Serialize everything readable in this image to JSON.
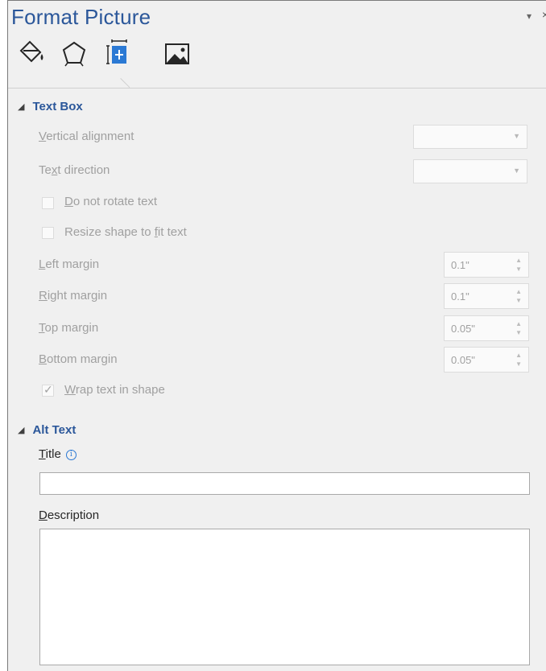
{
  "pane": {
    "title": "Format Picture",
    "menu_glyph": "▾",
    "close_glyph": "×"
  },
  "tabs": [
    {
      "name": "fill-line",
      "icon": "paint-bucket-icon"
    },
    {
      "name": "effects",
      "icon": "pentagon-icon"
    },
    {
      "name": "size-properties",
      "icon": "size-properties-icon",
      "selected": true
    },
    {
      "name": "picture",
      "icon": "picture-icon"
    }
  ],
  "text_box": {
    "heading": "Text Box",
    "vertical_alignment": {
      "mnemonic": "V",
      "rest": "ertical alignment",
      "value": ""
    },
    "text_direction": {
      "pre": "Te",
      "mnemonic": "x",
      "rest": "t direction",
      "value": ""
    },
    "do_not_rotate": {
      "mnemonic": "D",
      "rest": "o not rotate text",
      "checked": false
    },
    "resize_shape": {
      "pre": "Resize shape to ",
      "mnemonic": "f",
      "rest": "it text",
      "checked": false
    },
    "left_margin": {
      "mnemonic": "L",
      "rest": "eft margin",
      "value": "0.1\""
    },
    "right_margin": {
      "mnemonic": "R",
      "rest": "ight margin",
      "value": "0.1\""
    },
    "top_margin": {
      "mnemonic": "T",
      "rest": "op margin",
      "value": "0.05\""
    },
    "bottom_margin": {
      "mnemonic": "B",
      "rest": "ottom margin",
      "value": "0.05\""
    },
    "wrap_text": {
      "mnemonic": "W",
      "rest": "rap text in shape",
      "checked": true
    }
  },
  "alt_text": {
    "heading": "Alt Text",
    "title_label": {
      "mnemonic": "T",
      "rest": "itle"
    },
    "title_value": "",
    "description_label": {
      "mnemonic": "D",
      "rest": "escription"
    },
    "description_value": ""
  },
  "colors": {
    "accent": "#2b579a",
    "pane_background": "#f0f0f0",
    "disabled_text": "#a0a0a0"
  }
}
